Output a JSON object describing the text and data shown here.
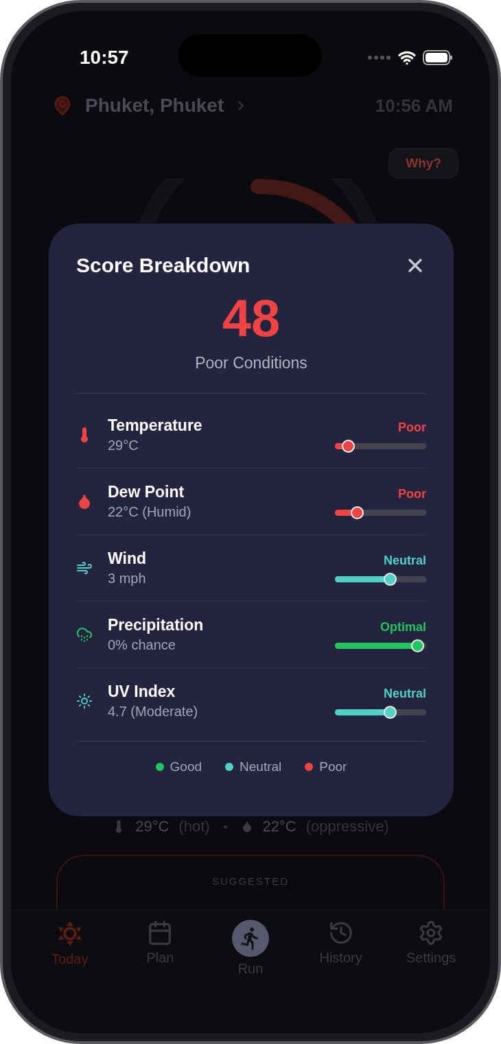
{
  "status_bar": {
    "time": "10:57"
  },
  "header": {
    "location": "Phuket, Phuket",
    "time": "10:56 AM"
  },
  "why_button": {
    "label": "Why?"
  },
  "summary": [
    {
      "kind": "thermometer",
      "value": "29°C",
      "note": "(hot)"
    },
    {
      "kind": "droplet",
      "value": "22°C",
      "note": "(oppressive)"
    }
  ],
  "suggested_card": {
    "label": "SUGGESTED"
  },
  "modal": {
    "title": "Score Breakdown",
    "score": "48",
    "condition": "Poor Conditions",
    "factors": [
      {
        "kind": "thermometer",
        "name": "Temperature",
        "value": "29°C",
        "rating": "Poor",
        "color": "#ef4444",
        "level": 0.14
      },
      {
        "kind": "droplet",
        "name": "Dew Point",
        "value": "22°C (Humid)",
        "rating": "Poor",
        "color": "#ef4444",
        "level": 0.24
      },
      {
        "kind": "wind",
        "name": "Wind",
        "value": "3 mph",
        "rating": "Neutral",
        "color": "#4fd1c5",
        "level": 0.6
      },
      {
        "kind": "rain",
        "name": "Precipitation",
        "value": "0% chance",
        "rating": "Optimal",
        "color": "#22c55e",
        "level": 0.9
      },
      {
        "kind": "sun",
        "name": "UV Index",
        "value": "4.7 (Moderate)",
        "rating": "Neutral",
        "color": "#4fd1c5",
        "level": 0.6
      }
    ],
    "legend": [
      {
        "label": "Good",
        "color": "#22c55e"
      },
      {
        "label": "Neutral",
        "color": "#4fd1c5"
      },
      {
        "label": "Poor",
        "color": "#ef4444"
      }
    ]
  },
  "tab_bar": [
    {
      "kind": "today",
      "label": "Today",
      "selected": true
    },
    {
      "kind": "plan",
      "label": "Plan",
      "selected": false
    },
    {
      "kind": "run",
      "label": "Run",
      "selected": false
    },
    {
      "kind": "history",
      "label": "History",
      "selected": false
    },
    {
      "kind": "settings",
      "label": "Settings",
      "selected": false
    }
  ]
}
